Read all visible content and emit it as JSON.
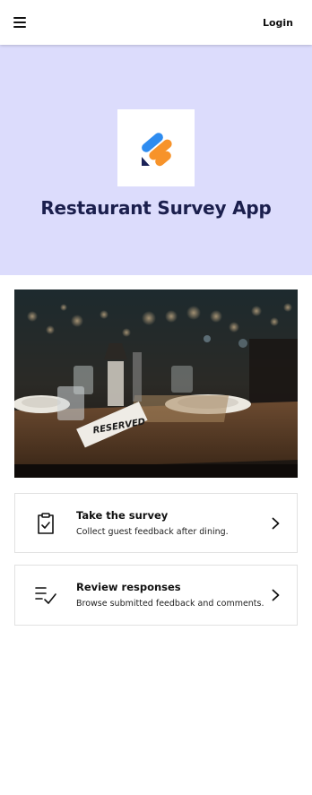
{
  "header": {
    "login_label": "Login",
    "menu_icon": "hamburger-menu-icon"
  },
  "hero": {
    "title": "Restaurant Survey App",
    "logo_icon": "app-logo",
    "background": "#dcdcfc",
    "title_color": "#1b1f4d"
  },
  "photo": {
    "sign_text": "RESERVED"
  },
  "cards": [
    {
      "title": "Take the survey",
      "description": "Collect guest feedback after dining.",
      "icon": "clipboard-check-icon"
    },
    {
      "title": "Review responses",
      "description": "Browse submitted feedback and comments.",
      "icon": "list-check-icon"
    }
  ],
  "colors": {
    "logo_blue": "#2e8cf0",
    "logo_orange": "#f7932a",
    "logo_navy": "#1b2257"
  }
}
